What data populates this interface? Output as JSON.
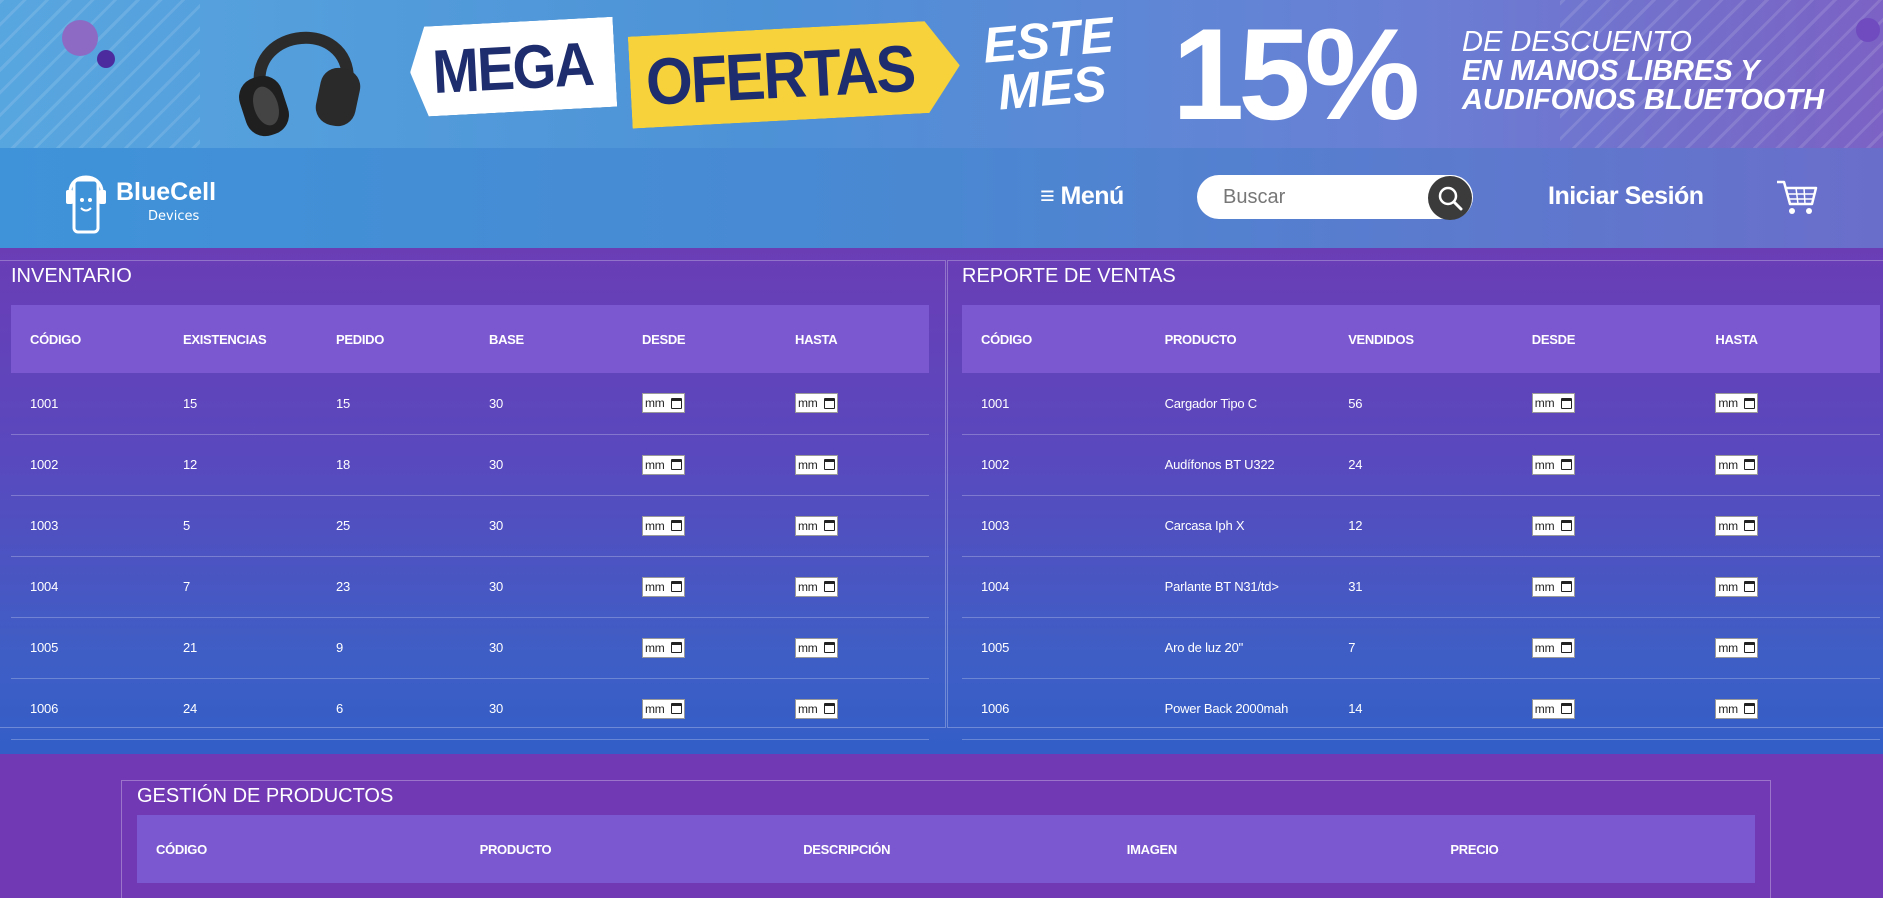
{
  "banner": {
    "mega": "MEGA",
    "ofertas": "OFERTAS",
    "este": "ESTE",
    "mes": "MES",
    "percent": "15%",
    "desc_line1": "DE DESCUENTO",
    "desc_line2": "EN MANOS LIBRES Y",
    "desc_line3": "AUDIFONOS BLUETOOTH"
  },
  "header": {
    "logo_name": "BlueCell",
    "logo_sub": "Devices",
    "menu_label": "≡ Menú",
    "search_placeholder": "Buscar",
    "login_label": "Iniciar Sesión",
    "icons": [
      "headphones-icon",
      "search-icon",
      "cart-icon"
    ]
  },
  "inventory": {
    "title": "INVENTARIO",
    "columns": [
      "CÓDIGO",
      "EXISTENCIAS",
      "PEDIDO",
      "BASE",
      "DESDE",
      "HASTA"
    ],
    "rows": [
      {
        "codigo": "1001",
        "existencias": "15",
        "pedido": "15",
        "base": "30"
      },
      {
        "codigo": "1002",
        "existencias": "12",
        "pedido": "18",
        "base": "30"
      },
      {
        "codigo": "1003",
        "existencias": "5",
        "pedido": "25",
        "base": "30"
      },
      {
        "codigo": "1004",
        "existencias": "7",
        "pedido": "23",
        "base": "30"
      },
      {
        "codigo": "1005",
        "existencias": "21",
        "pedido": "9",
        "base": "30"
      },
      {
        "codigo": "1006",
        "existencias": "24",
        "pedido": "6",
        "base": "30"
      }
    ],
    "date_placeholder": "mm"
  },
  "sales": {
    "title": "REPORTE DE VENTAS",
    "columns": [
      "CÓDIGO",
      "PRODUCTO",
      "VENDIDOS",
      "DESDE",
      "HASTA"
    ],
    "rows": [
      {
        "codigo": "1001",
        "producto": "Cargador Tipo C",
        "vendidos": "56"
      },
      {
        "codigo": "1002",
        "producto": "Audífonos BT U322",
        "vendidos": "24"
      },
      {
        "codigo": "1003",
        "producto": "Carcasa Iph X",
        "vendidos": "12"
      },
      {
        "codigo": "1004",
        "producto": "Parlante BT N31/td>",
        "vendidos": "31"
      },
      {
        "codigo": "1005",
        "producto": "Aro de luz 20\"",
        "vendidos": "7"
      },
      {
        "codigo": "1006",
        "producto": "Power Back 2000mah",
        "vendidos": "14"
      }
    ],
    "date_placeholder": "mm"
  },
  "products": {
    "title": "GESTIÓN DE PRODUCTOS",
    "columns": [
      "CÓDIGO",
      "PRODUCTO",
      "DESCRIPCIÓN",
      "IMAGEN",
      "PRECIO"
    ]
  },
  "colors": {
    "banner_blue": "#58a6e0",
    "nav_blue": "#3f93d9",
    "section_purple": "#6a3db5",
    "table_header": "#7b58cf",
    "accent_yellow": "#f7d23a",
    "accent_navy": "#1e2d6e"
  }
}
